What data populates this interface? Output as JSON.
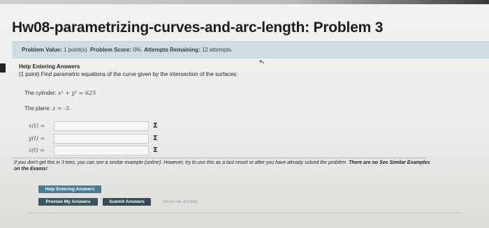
{
  "page": {
    "title": "Hw08-parametrizing-curves-and-arc-length: Problem 3"
  },
  "info_bar": {
    "problem_value_label": "Problem Value:",
    "problem_value": "1 point(s).",
    "problem_score_label": "Problem Score:",
    "problem_score": "0%.",
    "attempts_label": "Attempts Remaining:",
    "attempts": "12 attempts."
  },
  "problem": {
    "help_heading": "Help Entering Answers",
    "statement": "(1 point) Find parametric equations of the curve given by the intersection of the surfaces:",
    "cylinder_label": "The cylinder:",
    "cylinder_equation": "x² + y² = 625",
    "plane_label": "The plane:",
    "plane_equation": "z = -3."
  },
  "answers": [
    {
      "label": "x(t) =",
      "value": "",
      "sigma": "Σ"
    },
    {
      "label": "y(t) =",
      "value": "",
      "sigma": "Σ"
    },
    {
      "label": "z(t) =",
      "value": "",
      "sigma": "Σ"
    }
  ],
  "note": {
    "text": "If you don't get this in 3 tries, you can see a similar example (online). However, try to use this as a last resort or after you have already solved the problem.",
    "bold": "There are no See Similar Examples on the Exams!"
  },
  "buttons": {
    "help": "Help Entering Answers",
    "preview": "Preview My Answers",
    "submit": "Submit Answers",
    "another": "Show me another"
  },
  "colors": {
    "info_bar_bg": "#cfdce0",
    "help_button": "#4a7c95",
    "preview_button": "#3a5560",
    "submit_button": "#354a54"
  }
}
